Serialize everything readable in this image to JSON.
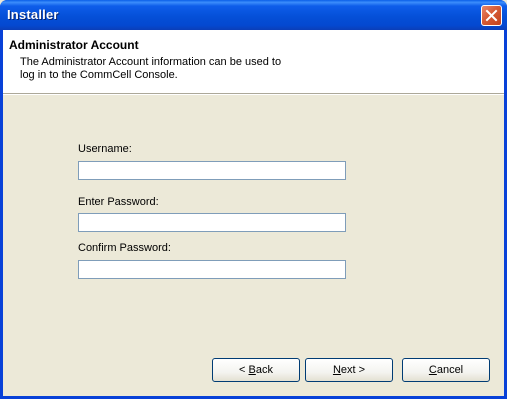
{
  "window": {
    "title": "Installer",
    "close_icon": "close-icon"
  },
  "header": {
    "title": "Administrator Account",
    "description_line1": "The Administrator Account information can be used to",
    "description_line2": "log in to the CommCell Console."
  },
  "form": {
    "username_label": "Username:",
    "username_value": "",
    "password_label": "Enter Password:",
    "password_value": "",
    "confirm_label": "Confirm Password:",
    "confirm_value": ""
  },
  "buttons": {
    "back_prefix": "< ",
    "back_accel": "B",
    "back_rest": "ack",
    "next_accel": "N",
    "next_rest": "ext >",
    "cancel_accel": "C",
    "cancel_rest": "ancel"
  },
  "colors": {
    "titlebar": "#0550D8",
    "dialog_bg": "#ECE9D8",
    "close_button": "#D65B36",
    "input_border": "#7F9DB9",
    "button_border": "#003C74"
  }
}
